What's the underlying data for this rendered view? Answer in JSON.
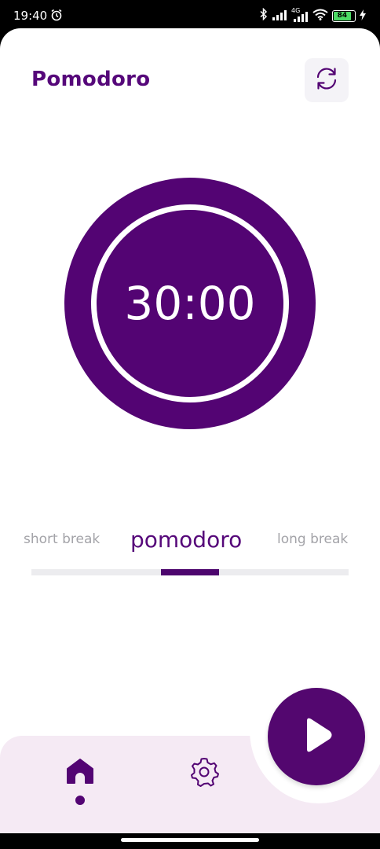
{
  "status_bar": {
    "time": "19:40",
    "network": "4G",
    "battery": "84",
    "icons": [
      "alarm-icon",
      "bluetooth-icon",
      "signal-icon",
      "signal-4g-icon",
      "wifi-icon",
      "battery-icon",
      "charging-icon"
    ]
  },
  "header": {
    "title": "Pomodoro",
    "refresh_icon": "refresh-icon"
  },
  "timer": {
    "display": "30:00"
  },
  "modes": {
    "items": [
      {
        "label": "short break",
        "active": false
      },
      {
        "label": "pomodoro",
        "active": true
      },
      {
        "label": "long break",
        "active": false
      }
    ]
  },
  "bottom_nav": {
    "items": [
      {
        "icon": "home-icon",
        "active": true
      },
      {
        "icon": "settings-icon",
        "active": false
      }
    ],
    "fab_icon": "play-icon"
  },
  "colors": {
    "primary": "#530473",
    "title": "#56087a",
    "inactive_text": "#a3a3a8",
    "nav_background": "#f5eaf4",
    "track": "#ececef"
  }
}
